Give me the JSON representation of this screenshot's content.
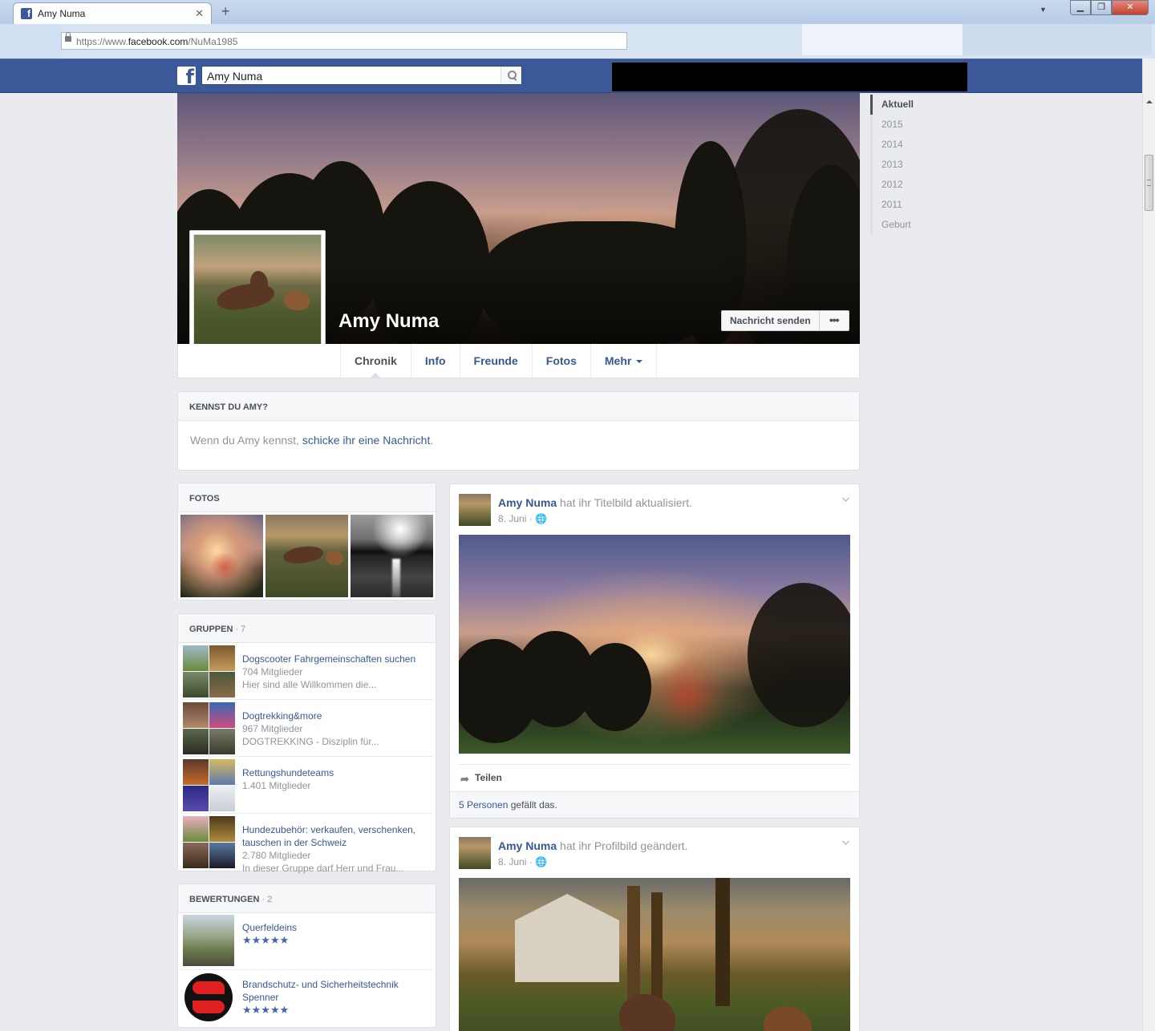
{
  "browser": {
    "tab_title": "Amy Numa",
    "tab_close": "✕",
    "new_tab": "+",
    "tab_dropdown": "▼",
    "url_prefix": "https://www.",
    "url_host": "facebook.com",
    "url_path": "/NuMa1985",
    "win_min": "▁",
    "win_max": "❐",
    "win_close": "✕"
  },
  "fb": {
    "logo": "f",
    "search_value": "Amy Numa"
  },
  "profile": {
    "name": "Amy Numa",
    "send_message": "Nachricht senden",
    "more": "•••"
  },
  "nav": {
    "tabs": [
      "Chronik",
      "Info",
      "Freunde",
      "Fotos",
      "Mehr"
    ]
  },
  "know": {
    "title": "KENNST DU AMY?",
    "text_before": "Wenn du Amy kennst, ",
    "link": "schicke ihr eine Nachricht",
    "text_after": "."
  },
  "photos": {
    "title": "FOTOS"
  },
  "groups": {
    "title": "GRUPPEN",
    "count": " · 7",
    "items": [
      {
        "name": "Dogscooter Fahrgemeinschaften suchen",
        "members": "704 Mitglieder",
        "desc": "Hier sind alle Willkommen die..."
      },
      {
        "name": "Dogtrekking&more",
        "members": "967 Mitglieder",
        "desc": "DOGTREKKING - Disziplin für..."
      },
      {
        "name": "Rettungshundeteams",
        "members": "1.401 Mitglieder",
        "desc": ""
      },
      {
        "name": "Hundezubehör: verkaufen, verschenken, tauschen in der Schweiz",
        "members": "2.780 Mitglieder",
        "desc": "In dieser Gruppe darf Herr und Frau..."
      }
    ]
  },
  "reviews": {
    "title": "BEWERTUNGEN",
    "count": " · 2",
    "items": [
      {
        "name": "Querfeldeins",
        "stars": "★★★★★"
      },
      {
        "name": "Brandschutz- und Sicherheitstechnik Spenner",
        "stars": "★★★★★"
      }
    ]
  },
  "posts": [
    {
      "author": "Amy Numa",
      "action": " hat ihr Titelbild aktualisiert.",
      "date": "8. Juni",
      "privacy": " · 🌐",
      "share": "Teilen",
      "share_icon": "➦",
      "likes_link": "5 Personen",
      "likes_text": " gefällt das."
    },
    {
      "author": "Amy Numa",
      "action": " hat ihr Profilbild geändert.",
      "date": "8. Juni",
      "privacy": " · 🌐"
    }
  ],
  "timeline": [
    "Aktuell",
    "2015",
    "2014",
    "2013",
    "2012",
    "2011",
    "Geburt"
  ]
}
